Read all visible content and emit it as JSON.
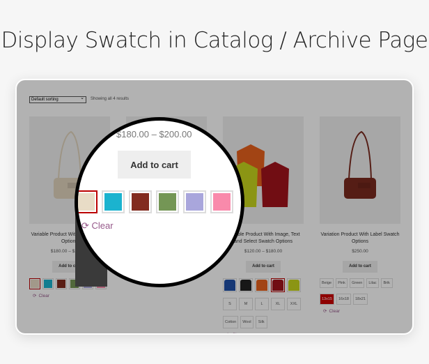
{
  "title": "Display Swatch in Catalog / Archive Page",
  "toolbar": {
    "sort": "Default sorting",
    "result_count": "Showing all 4 results"
  },
  "products": [
    {
      "name": "Variable Product With Color Swatch Options",
      "price": "$180.00 – $200.00",
      "button": "Add to cart",
      "clear": "Clear",
      "colors": [
        "#e8dcc6",
        "#1bb3cf",
        "#822b1f",
        "#749655",
        "#a9a6dc",
        "#f98aab"
      ],
      "selected": 0
    },
    {
      "name": "",
      "price": "",
      "button": "Add to cart",
      "clear": "Clear",
      "colors": [
        "#e8dcc6",
        "#1bb3cf",
        "#822b1f",
        "#749655",
        "#a9a6dc",
        "#f98aab"
      ],
      "selected": 3
    },
    {
      "name": "Variable Product With Image, Text and Select Swatch Options",
      "price": "$120.00 – $180.00",
      "button": "Add to cart",
      "clear": "Clear",
      "shirts": [
        "#1f4fa8",
        "#222222",
        "#e8621d",
        "#a3131c",
        "#c8d61d"
      ],
      "selected": 3,
      "sizes": [
        "S",
        "M",
        "L",
        "XL",
        "XXL"
      ],
      "materials": [
        "Cotton",
        "Wool",
        "Silk"
      ]
    },
    {
      "name": "Variation Product With Label Swatch Options",
      "price": "$250.00",
      "button": "Add to cart",
      "clear": "Clear",
      "labels": [
        "Beige",
        "Pink",
        "Green",
        "Lilac",
        "Brik"
      ],
      "dimensions": [
        "13x15",
        "16x18",
        "18x21"
      ],
      "selected_dimension": 0
    }
  ],
  "magnifier": {
    "price": "$180.00 – $200.00",
    "button": "Add to cart",
    "clear": "Clear",
    "colors": [
      "#e8dcc6",
      "#1bb3cf",
      "#822b1f",
      "#749655",
      "#a9a6dc",
      "#f98aab"
    ],
    "selected": 0
  }
}
